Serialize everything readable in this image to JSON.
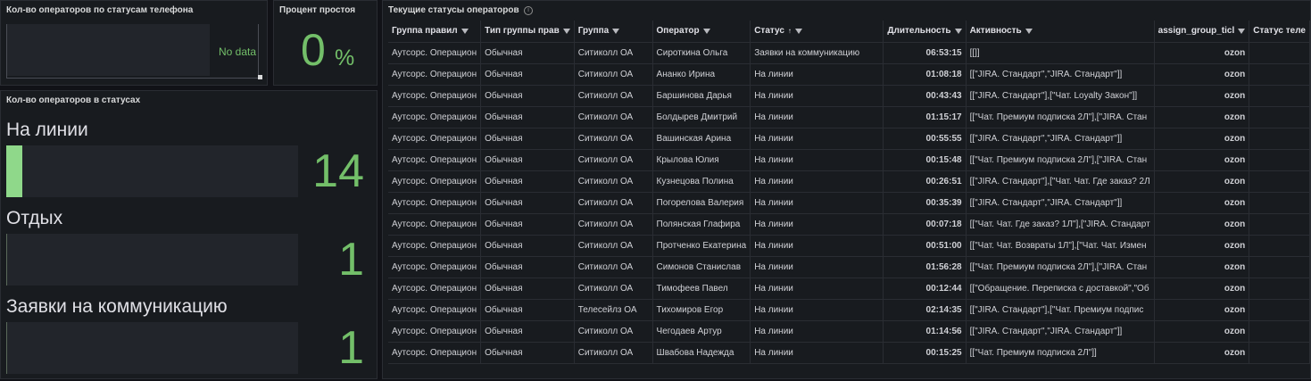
{
  "panel_phone": {
    "title": "Кол-во операторов по статусам телефона",
    "no_data": "No data"
  },
  "panel_idle": {
    "title": "Процент простоя",
    "value": "0",
    "unit": "%"
  },
  "panel_status": {
    "title": "Кол-во операторов в статусах",
    "items": [
      {
        "label": "На линии",
        "value": "14",
        "fill": 1.0
      },
      {
        "label": "Отдых",
        "value": "1",
        "fill": 0.0
      },
      {
        "label": "Заявки на коммуникацию",
        "value": "1",
        "fill": 0.0
      }
    ]
  },
  "panel_table": {
    "title": "Текущие статусы операторов",
    "columns": [
      "Группа правил",
      "Тип группы прав",
      "Группа",
      "Оператор",
      "Статус",
      "Длительность",
      "Активность",
      "assign_group_ticl",
      "Статус теле"
    ],
    "rows": [
      [
        "Аутсорс. Операцион",
        "Обычная",
        "Ситиколл ОА",
        "Сироткина Ольга",
        "Заявки на коммуникацию",
        "06:53:15",
        "[[]]",
        "ozon",
        ""
      ],
      [
        "Аутсорс. Операцион",
        "Обычная",
        "Ситиколл ОА",
        "Ананко Ирина",
        "На линии",
        "01:08:18",
        "[[\"JIRA. Стандарт\",\"JIRA. Стандарт\"]]",
        "ozon",
        ""
      ],
      [
        "Аутсорс. Операцион",
        "Обычная",
        "Ситиколл ОА",
        "Баршинова Дарья",
        "На линии",
        "00:43:43",
        "[[\"JIRA. Стандарт\"],[\"Чат. Loyalty Закон\"]]",
        "ozon",
        ""
      ],
      [
        "Аутсорс. Операцион",
        "Обычная",
        "Ситиколл ОА",
        "Болдырев Дмитрий",
        "На линии",
        "01:15:17",
        "[[\"Чат. Премиум подписка 2Л\"],[\"JIRA. Стан",
        "ozon",
        ""
      ],
      [
        "Аутсорс. Операцион",
        "Обычная",
        "Ситиколл ОА",
        "Вашинская Арина",
        "На линии",
        "00:55:55",
        "[[\"JIRA. Стандарт\",\"JIRA. Стандарт\"]]",
        "ozon",
        ""
      ],
      [
        "Аутсорс. Операцион",
        "Обычная",
        "Ситиколл ОА",
        "Крылова Юлия",
        "На линии",
        "00:15:48",
        "[[\"Чат. Премиум подписка 2Л\"],[\"JIRA. Стан",
        "ozon",
        ""
      ],
      [
        "Аутсорс. Операцион",
        "Обычная",
        "Ситиколл ОА",
        "Кузнецова Полина",
        "На линии",
        "00:26:51",
        "[[\"JIRA. Стандарт\"],[\"Чат. Чат. Где заказ? 2Л",
        "ozon",
        ""
      ],
      [
        "Аутсорс. Операцион",
        "Обычная",
        "Ситиколл ОА",
        "Погорелова Валерия",
        "На линии",
        "00:35:39",
        "[[\"JIRA. Стандарт\",\"JIRA. Стандарт\"]]",
        "ozon",
        ""
      ],
      [
        "Аутсорс. Операцион",
        "Обычная",
        "Ситиколл ОА",
        "Полянская Глафира",
        "На линии",
        "00:07:18",
        "[[\"Чат. Чат. Где заказ? 1Л\"],[\"JIRA. Стандарт",
        "ozon",
        ""
      ],
      [
        "Аутсорс. Операцион",
        "Обычная",
        "Ситиколл ОА",
        "Протченко Екатерина",
        "На линии",
        "00:51:00",
        "[[\"Чат. Чат. Возвраты 1Л\"],[\"Чат. Чат. Измен",
        "ozon",
        ""
      ],
      [
        "Аутсорс. Операцион",
        "Обычная",
        "Ситиколл ОА",
        "Симонов Станислав",
        "На линии",
        "01:56:28",
        "[[\"Чат. Премиум подписка 2Л\"],[\"JIRA. Стан",
        "ozon",
        ""
      ],
      [
        "Аутсорс. Операцион",
        "Обычная",
        "Ситиколл ОА",
        "Тимофеев Павел",
        "На линии",
        "00:12:44",
        "[[\"Обращение. Переписка с доставкой\",\"Об",
        "ozon",
        ""
      ],
      [
        "Аутсорс. Операцион",
        "Обычная",
        "Телесейлз ОА",
        "Тихомиров Егор",
        "На линии",
        "02:14:35",
        "[[\"JIRA. Стандарт\"],[\"Чат. Премиум подпис",
        "ozon",
        ""
      ],
      [
        "Аутсорс. Операцион",
        "Обычная",
        "Ситиколл ОА",
        "Чегодаев Артур",
        "На линии",
        "01:14:56",
        "[[\"JIRA. Стандарт\",\"JIRA. Стандарт\"]]",
        "ozon",
        ""
      ],
      [
        "Аутсорс. Операцион",
        "Обычная",
        "Ситиколл ОА",
        "Швабова Надежда",
        "На линии",
        "00:15:25",
        "[[\"Чат. Премиум подписка 2Л\"]]",
        "ozon",
        ""
      ]
    ]
  },
  "colors": {
    "accent_green": "#73bf69",
    "bar_fill": "#8fd88a",
    "panel_bg": "#181b1f",
    "page_bg": "#111217"
  }
}
